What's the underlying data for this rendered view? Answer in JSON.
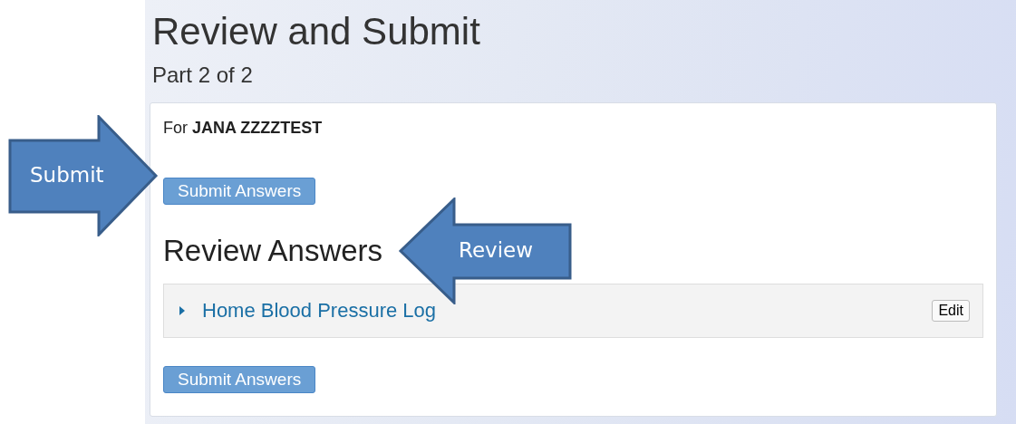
{
  "header": {
    "title": "Review and Submit",
    "subtitle": "Part 2 of 2"
  },
  "card": {
    "for_label": "For",
    "patient": "JANA ZZZZTEST",
    "submit_top": "Submit Answers",
    "section_title": "Review Answers",
    "forms": [
      {
        "title": "Home Blood Pressure Log",
        "expanded": false,
        "edit": "Edit"
      }
    ],
    "submit_bottom": "Submit Answers"
  },
  "callouts": [
    {
      "kind": "right",
      "label": "Submit"
    },
    {
      "kind": "left",
      "label": "Review"
    }
  ]
}
